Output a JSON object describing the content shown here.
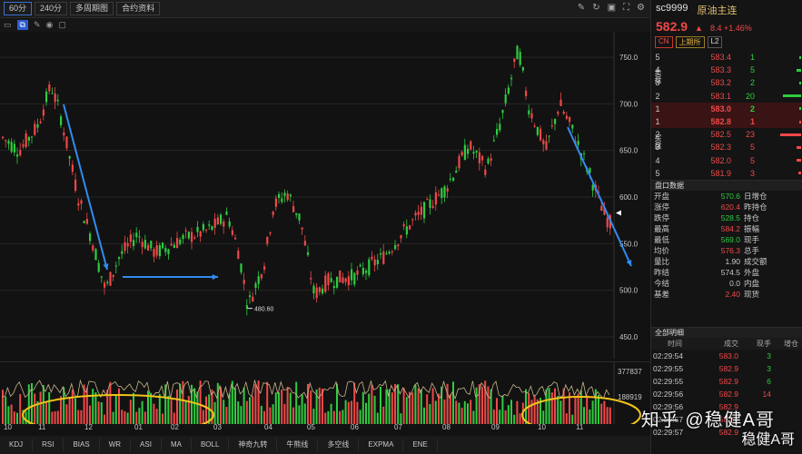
{
  "toolbar": {
    "buttons": [
      "60分",
      "240分",
      "多周期图",
      "合约资料"
    ],
    "right_icons": [
      "edit-icon",
      "refresh-icon",
      "image-icon",
      "fullscreen-icon",
      "settings-icon"
    ]
  },
  "chart": {
    "price_ticks": [
      "750.0",
      "700.0",
      "650.0",
      "600.0",
      "550.0",
      "500.0",
      "450.0"
    ],
    "low_marker": "480.60",
    "volume_ticks": [
      "377837",
      "188919"
    ],
    "date_labels": [
      "10",
      "11",
      "12",
      "01",
      "02",
      "03",
      "04",
      "05",
      "06",
      "07",
      "08",
      "09",
      "10",
      "11"
    ],
    "controls": [
      "⊖",
      "⊕",
      "‹",
      "›"
    ]
  },
  "indicators": [
    "KDJ",
    "RSI",
    "BIAS",
    "WR",
    "ASI",
    "MA",
    "BOLL",
    "神奇九转",
    "牛熊线",
    "多空线",
    "EXPMA",
    "ENE"
  ],
  "panel": {
    "code": "sc9999",
    "name": "原油主连",
    "last": "582.9",
    "arrow": "▲",
    "change": "8.4 +1.46%",
    "tags": [
      "CN",
      "上期所",
      "L2"
    ],
    "sell_label": "卖盘",
    "buy_label": "买盘",
    "asks": [
      {
        "lvl": "5",
        "px": "583.4",
        "qty": "1",
        "qcolor": "#2ecc40"
      },
      {
        "lvl": "4",
        "px": "583.3",
        "qty": "5",
        "qcolor": "#2ecc40"
      },
      {
        "lvl": "3",
        "px": "583.2",
        "qty": "2",
        "qcolor": "#2ecc40"
      },
      {
        "lvl": "2",
        "px": "583.1",
        "qty": "20",
        "qcolor": "#2ecc40"
      },
      {
        "lvl": "1",
        "px": "583.0",
        "qty": "2",
        "qcolor": "#2ecc40"
      }
    ],
    "bids": [
      {
        "lvl": "1",
        "px": "582.8",
        "qty": "1",
        "qcolor": "#f04848"
      },
      {
        "lvl": "2",
        "px": "582.5",
        "qty": "23",
        "qcolor": "#f04848"
      },
      {
        "lvl": "3",
        "px": "582.3",
        "qty": "5",
        "qcolor": "#f04848"
      },
      {
        "lvl": "4",
        "px": "582.0",
        "qty": "5",
        "qcolor": "#f04848"
      },
      {
        "lvl": "5",
        "px": "581.9",
        "qty": "3",
        "qcolor": "#f04848"
      }
    ],
    "stats_title": "盘口数据",
    "stats": [
      {
        "k": "开盘",
        "v": "570.6",
        "vc": "#2ecc40",
        "k2": "日增仓"
      },
      {
        "k": "涨停",
        "v": "620.4",
        "vc": "#f04848",
        "k2": "昨持仓"
      },
      {
        "k": "跌停",
        "v": "528.5",
        "vc": "#2ecc40",
        "k2": "持仓"
      },
      {
        "k": "最高",
        "v": "584.2",
        "vc": "#f04848",
        "k2": "振幅"
      },
      {
        "k": "最低",
        "v": "569.0",
        "vc": "#2ecc40",
        "k2": "现手"
      },
      {
        "k": "均价",
        "v": "576.3",
        "vc": "#f04848",
        "k2": "总手"
      },
      {
        "k": "量比",
        "v": "1.90",
        "vc": "#c8c8c8",
        "k2": "成交额"
      },
      {
        "k": "昨结",
        "v": "574.5",
        "vc": "#c8c8c8",
        "k2": "外盘"
      },
      {
        "k": "今结",
        "v": "0.0",
        "vc": "#c8c8c8",
        "k2": "内盘"
      },
      {
        "k": "基差",
        "v": "2.40",
        "vc": "#f04848",
        "k2": "现货"
      }
    ],
    "ticks_title": "全部明细",
    "tick_headers": [
      "时间",
      "成交",
      "现手",
      "增仓"
    ],
    "ticks": [
      {
        "t": "02:29:54",
        "p": "583.0",
        "v": "3",
        "vc": "#2ecc40"
      },
      {
        "t": "02:29:55",
        "p": "582.9",
        "v": "3",
        "vc": "#2ecc40"
      },
      {
        "t": "02:29:55",
        "p": "582.9",
        "v": "6",
        "vc": "#2ecc40"
      },
      {
        "t": "02:29:56",
        "p": "582.9",
        "v": "14",
        "vc": "#f04848"
      },
      {
        "t": "02:29:56",
        "p": "582.9",
        "v": "",
        "vc": "#f04848"
      },
      {
        "t": "02:29:57",
        "p": "582.9",
        "v": "",
        "vc": "#f04848"
      },
      {
        "t": "02:29:57",
        "p": "582.9",
        "v": "",
        "vc": "#f04848"
      }
    ]
  },
  "watermark": "知乎 @稳健A哥",
  "watermark2": "稳健A哥"
}
